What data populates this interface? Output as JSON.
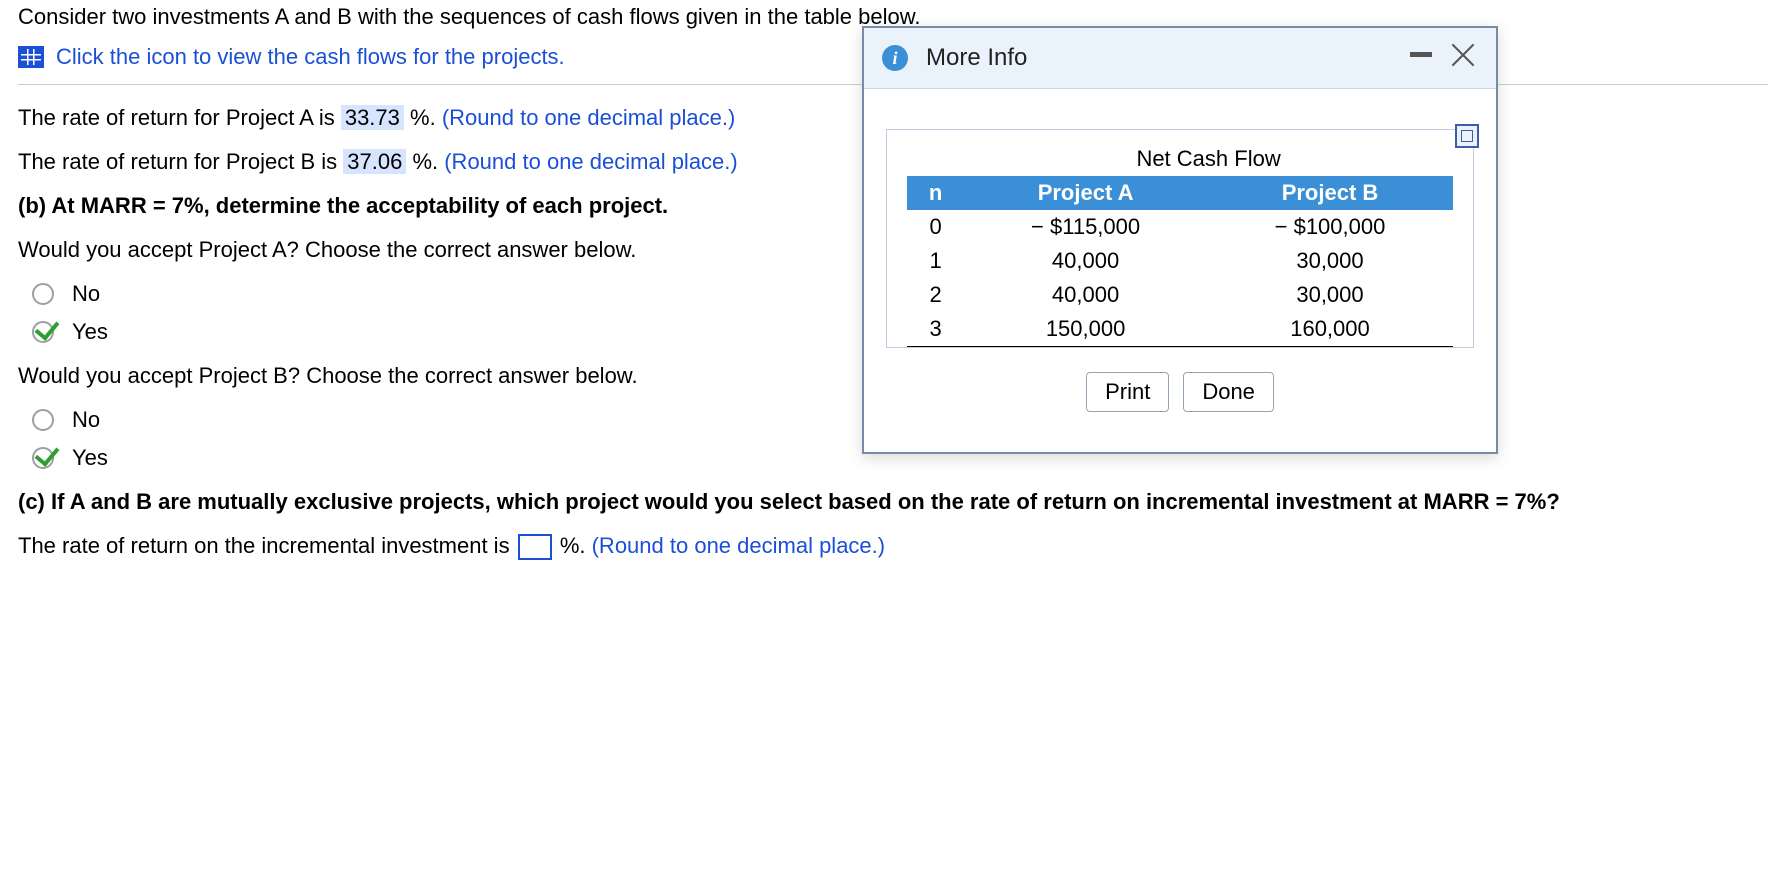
{
  "intro": "Consider two investments A and B with the sequences of cash flows given in the table below.",
  "link_text": "Click the icon to view the cash flows for the projects.",
  "line_a_prefix": "The rate of return for Project A is ",
  "line_a_value": "33.73",
  "line_a_suffix": " %. ",
  "line_b_prefix": "The rate of return for Project B is ",
  "line_b_value": "37.06",
  "line_b_suffix": " %. ",
  "round_hint": "(Round to one decimal place.)",
  "part_b": "(b) At MARR = 7%, determine the acceptability of each project.",
  "q_a": "Would you accept Project A? Choose the correct answer below.",
  "q_b": "Would you accept Project B? Choose the correct answer below.",
  "opt_no": "No",
  "opt_yes": "Yes",
  "part_c": "(c) If A and B are mutually exclusive projects, which project would you select based on the rate of return on incremental investment at MARR = 7%?",
  "incr_prefix": "The rate of return on the incremental investment is ",
  "incr_suffix": "%. ",
  "modal": {
    "title": "More Info",
    "super_header": "Net Cash Flow",
    "headers": {
      "n": "n",
      "a": "Project A",
      "b": "Project B"
    },
    "rows": [
      {
        "n": "0",
        "a": "− $115,000",
        "b": "− $100,000"
      },
      {
        "n": "1",
        "a": "40,000",
        "b": "30,000"
      },
      {
        "n": "2",
        "a": "40,000",
        "b": "30,000"
      },
      {
        "n": "3",
        "a": "150,000",
        "b": "160,000"
      }
    ],
    "print": "Print",
    "done": "Done"
  }
}
